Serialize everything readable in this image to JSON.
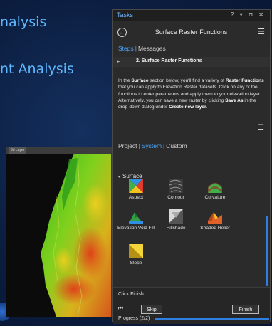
{
  "background": {
    "line1": "nalysis",
    "line2": "nt Analysis"
  },
  "map_window": {
    "tab_label": "3d Layer"
  },
  "tasks_panel": {
    "title": "Tasks",
    "titlebar_icons": "? ▾ ⊓ ✕",
    "task_name": "Surface Raster Functions",
    "subtabs": {
      "steps": "Steps",
      "separator": "|",
      "messages": "Messages"
    },
    "step": {
      "arrow": "▸",
      "title": "2. Surface Raster Functions"
    },
    "instructions": {
      "p1": "In the ",
      "b1": "Surface",
      "p2": " section below, you'll find a variety of ",
      "b2": "Raster Functions",
      "p3": " that you can apply to Elevation Raster datasets. Click on any of the functions to enter parameters and apply them to your elevation layer. Alternatively, you can save a new raster by clicking ",
      "b3": "Save As",
      "p4": " in the drop-down dialog under ",
      "b4": "Create new layer",
      "p5": "."
    },
    "categories": {
      "project": "Project",
      "system": "System",
      "custom": "Custom",
      "separator": "|"
    },
    "group": {
      "arrow": "▾",
      "label": "Surface"
    },
    "functions": [
      {
        "label": "Aspect",
        "icon": "aspect-icon"
      },
      {
        "label": "Contour",
        "icon": "contour-icon"
      },
      {
        "label": "Curvature",
        "icon": "curvature-icon"
      },
      {
        "label": "Elevation Void Fill",
        "icon": "elevation-void-fill-icon"
      },
      {
        "label": "Hillshade",
        "icon": "hillshade-icon"
      },
      {
        "label": "Shaded Relief",
        "icon": "shaded-relief-icon"
      },
      {
        "label": "Slope",
        "icon": "slope-icon"
      }
    ],
    "footer": {
      "click_finish": "Click Finish",
      "first_icon": "⏮",
      "skip": "Skip",
      "finish": "Finish",
      "progress_label": "Progress (2/2)",
      "progress_fraction": 1.0
    }
  },
  "colors": {
    "accent": "#4aa7ff",
    "progress": "#2e7fe0",
    "bg_text": "#5fb8ff"
  }
}
